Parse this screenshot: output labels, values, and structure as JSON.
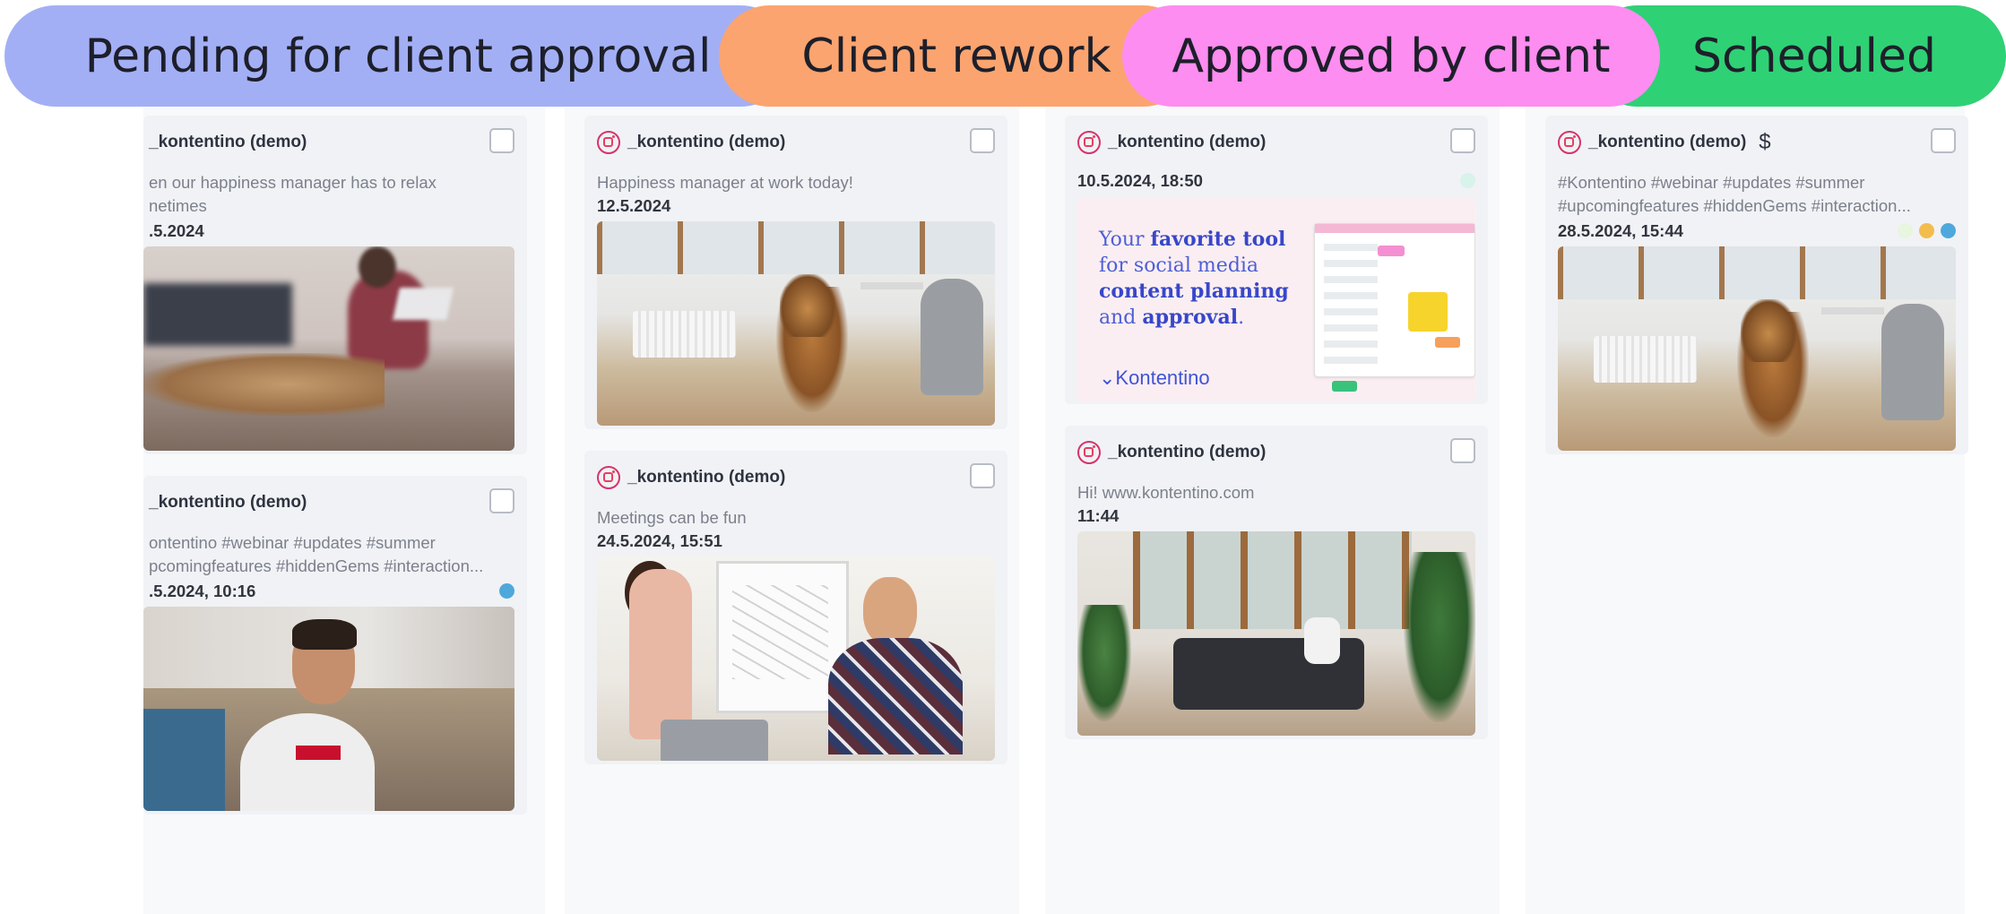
{
  "statuses": [
    {
      "label": "Pending for client approval",
      "color": "#a3aff5"
    },
    {
      "label": "Client rework",
      "color": "#fba46f"
    },
    {
      "label": "Approved by client",
      "color": "#fd8df0"
    },
    {
      "label": "Scheduled",
      "color": "#2fd175"
    }
  ],
  "columns": [
    {
      "cards": [
        {
          "account": "_kontentino (demo)",
          "caption_line1": "en our happiness manager has to relax",
          "caption_line2": "netimes",
          "date": ".5.2024",
          "image": "sleeping dog"
        },
        {
          "account": "_kontentino (demo)",
          "caption_line1": "ontentino #webinar #updates #summer",
          "caption_line2": "pcomingfeatures #hiddenGems #interaction...",
          "date": ".5.2024, 10:16",
          "dot_colors": [
            "#4fa8dc"
          ],
          "image": "man at laptop"
        }
      ]
    },
    {
      "cards": [
        {
          "account": "_kontentino (demo)",
          "caption": "Happiness manager at work today!",
          "date": "12.5.2024",
          "image": "dog in office"
        },
        {
          "account": "_kontentino (demo)",
          "caption": "Meetings can be fun",
          "date": "24.5.2024, 15:51",
          "image": "meeting"
        }
      ]
    },
    {
      "cards": [
        {
          "account": "_kontentino (demo)",
          "date": "10.5.2024, 18:50",
          "dot_colors": [
            "#d7f3ea"
          ],
          "image": "promo",
          "promo": {
            "line1a": "Your ",
            "line1b": "favorite tool",
            "line2": "for social media",
            "line3": "content planning",
            "line4a": "and ",
            "line4b": "approval",
            "line4c": ".",
            "logo": "⌄Kontentino"
          }
        },
        {
          "account": "_kontentino (demo)",
          "caption": "Hi! www.kontentino.com",
          "date": "11:44",
          "image": "sofa"
        }
      ]
    },
    {
      "cards": [
        {
          "account": "_kontentino (demo)",
          "caption_line1": "#Kontentino #webinar #updates #summer",
          "caption_line2": "#upcomingfeatures #hiddenGems #interaction...",
          "date": "28.5.2024, 15:44",
          "dot_colors": [
            "#e8f5df",
            "#f2bd4c",
            "#4fa8dc"
          ],
          "image": "dog in office",
          "paid_icon": "$"
        }
      ]
    }
  ]
}
